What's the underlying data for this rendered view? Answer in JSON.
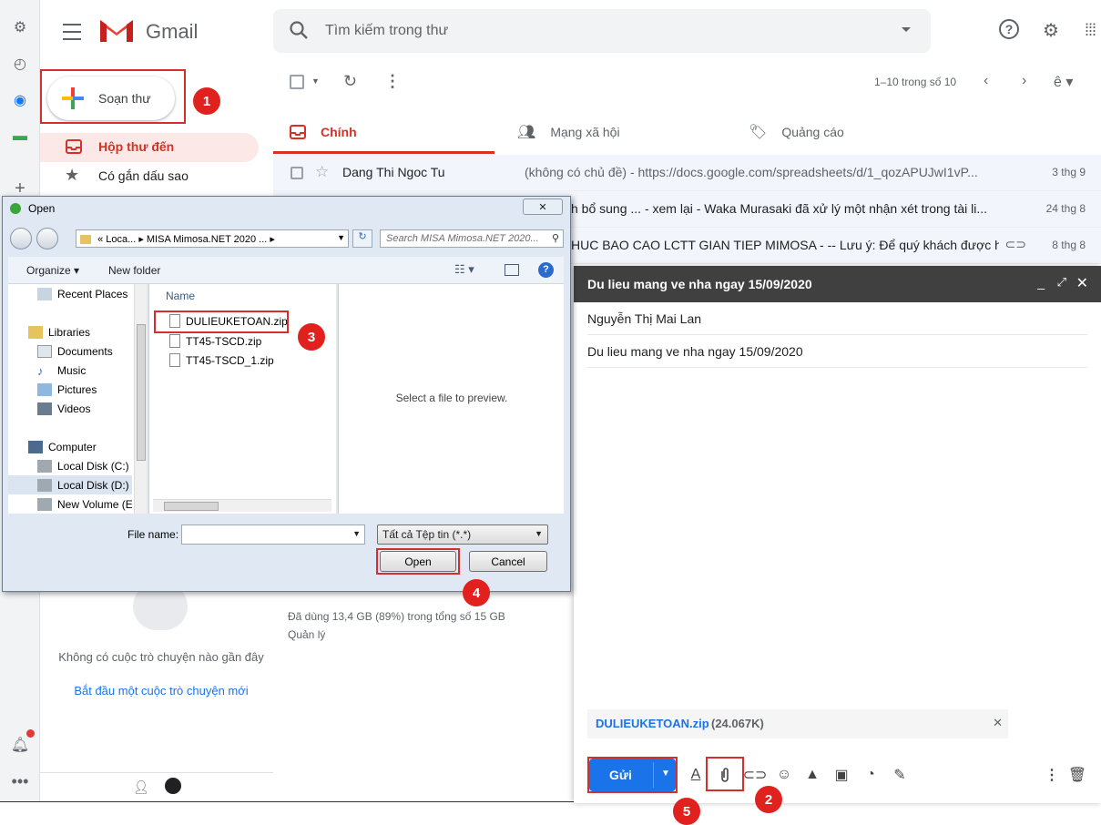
{
  "app": {
    "name": "Gmail"
  },
  "search": {
    "placeholder": "Tìm kiếm trong thư"
  },
  "compose_button": {
    "label": "Soạn thư"
  },
  "nav": {
    "inbox": "Hộp thư đến",
    "starred": "Có gắn dấu sao"
  },
  "toolbar": {
    "pagination": "1–10 trong số 10"
  },
  "tabs": [
    {
      "label": "Chính"
    },
    {
      "label": "Mạng xã hội"
    },
    {
      "label": "Quảng cáo"
    }
  ],
  "emails": [
    {
      "sender": "Dang Thi Ngoc Tu",
      "subject": "(không có chủ đề) - https://docs.google.com/spreadsheets/d/1_qozAPUJwI1vP...",
      "date": "3 thg 9"
    },
    {
      "sender": "",
      "subject": "h bổ sung ... - xem lại - Waka Murasaki đã xử lý một nhận xét trong tài li...",
      "date": "24 thg 8"
    },
    {
      "sender": "",
      "subject": "HUC BAO CAO LCTT GIAN TIEP MIMOSA - -- Lưu ý: Để quý khách được h...",
      "date": "8 thg 8"
    }
  ],
  "storage": {
    "text": "Đã dùng 13,4 GB (89%) trong tổng số 15 GB",
    "manage": "Quản lý"
  },
  "chat": {
    "empty": "Không có cuộc trò chuyện nào gần đây",
    "start": "Bắt đầu một cuộc trò chuyện mới"
  },
  "compose_window": {
    "title": "Du lieu mang ve nha ngay 15/09/2020",
    "to": "Nguyễn Thị Mai Lan",
    "subject": "Du lieu mang ve nha ngay 15/09/2020",
    "attachment_name": "DULIEUKETOAN.zip",
    "attachment_size": "(24.067K)",
    "send_label": "Gửi"
  },
  "dialog": {
    "title": "Open",
    "path": "«  Loca...  ▸  MISA Mimosa.NET 2020 ...  ▸",
    "search_placeholder": "Search MISA Mimosa.NET 2020...",
    "organize": "Organize",
    "new_folder": "New folder",
    "tree": [
      "Recent Places",
      "Libraries",
      "Documents",
      "Music",
      "Pictures",
      "Videos",
      "Computer",
      "Local Disk (C:)",
      "Local Disk (D:)",
      "New Volume (E:"
    ],
    "column_name": "Name",
    "files": [
      "DULIEUKETOAN.zip",
      "TT45-TSCD.zip",
      "TT45-TSCD_1.zip"
    ],
    "preview": "Select a file to preview.",
    "file_name_label": "File name:",
    "file_type": "Tất cả Tệp tin (*.*)",
    "open": "Open",
    "cancel": "Cancel"
  },
  "steps": [
    "1",
    "2",
    "3",
    "4",
    "5"
  ],
  "colors": {
    "accent_red": "#d93025",
    "send_blue": "#1a73e8",
    "annotation_red": "#e0211e"
  }
}
